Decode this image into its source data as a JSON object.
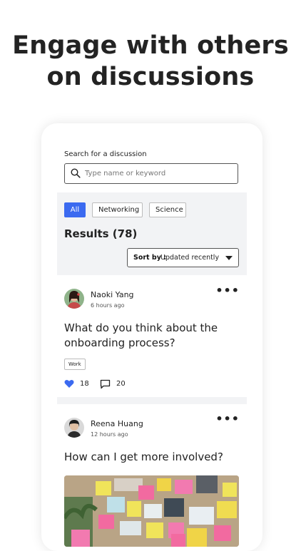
{
  "headline": {
    "line1": "Engage with others",
    "line2": "on discussions"
  },
  "search": {
    "label": "Search for a discussion",
    "placeholder": "Type name or keyword"
  },
  "filters": {
    "items": [
      {
        "label": "All",
        "active": true
      },
      {
        "label": "Networking",
        "active": false
      },
      {
        "label": "Science",
        "active": false
      }
    ]
  },
  "results": {
    "text": "Results (78)"
  },
  "sort": {
    "label": "Sort by :",
    "value": "Updated recently"
  },
  "posts": [
    {
      "author": "Naoki Yang",
      "time": "6 hours ago",
      "title_line1": "What do you think about the",
      "title_line2": "onboarding process?",
      "tag": "Work",
      "likes": "18",
      "comments": "20",
      "more": "•••"
    },
    {
      "author": "Reena Huang",
      "time": "12 hours ago",
      "title_line1": "How can I get more involved?",
      "more": "•••"
    }
  ],
  "colors": {
    "accent": "#3b6af0",
    "panel": "#f2f3f5",
    "like": "#3b6af0"
  }
}
